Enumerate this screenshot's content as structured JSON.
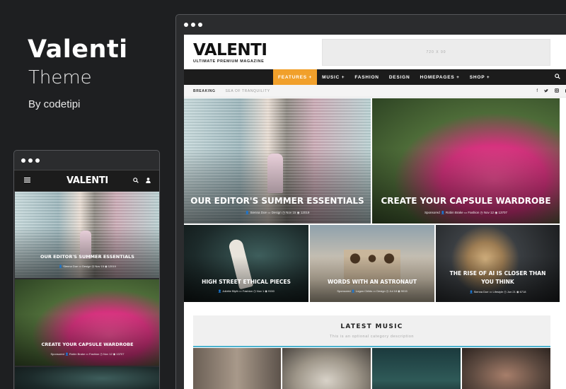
{
  "hero": {
    "title": "Valenti",
    "subtitle": "Theme",
    "by": "By codetipi"
  },
  "desktop": {
    "logo": "VALENTI",
    "tagline": "ULTIMATE PREMIUM MAGAZINE",
    "ad_text": "720 X 90",
    "nav": [
      {
        "label": "FEATURES +"
      },
      {
        "label": "MUSIC +"
      },
      {
        "label": "FASHION"
      },
      {
        "label": "DESIGN"
      },
      {
        "label": "HOMEPAGES +"
      },
      {
        "label": "SHOP +"
      }
    ],
    "breaking_label": "BREAKING",
    "breaking_text": "SEA OF TRANQUILITY",
    "big_cards": [
      {
        "title": "OUR EDITOR'S SUMMER ESSENTIALS",
        "meta": "👤 Sienna Doe  ▭ Design  ◷ Nov 15  ◉ 12019"
      },
      {
        "title": "CREATE YOUR CAPSULE WARDROBE",
        "meta": "Sponsored  👤 Robin Brake  ▭ Fashion  ◷ Nov 12  ◉ 13707"
      }
    ],
    "small_cards": [
      {
        "title": "HIGH STREET ETHICAL PIECES",
        "meta": "👤 Juliette Blyth  ▭ Fashion  ◷ Nov 1  ◉ 9150"
      },
      {
        "title": "WORDS WITH AN ASTRONAUT",
        "meta": "Sponsored  👤 Logan Childs  ▭ Design  ◷ Jul 18  ◉ 9015"
      },
      {
        "title": "THE RISE OF AI IS CLOSER THAN YOU THINK",
        "meta": "👤 Sienna Doe  ▭ Lifestyle  ◷ Jun 21  ◉ 6718"
      }
    ],
    "section_title": "LATEST MUSIC",
    "section_desc": "This is an optional category description"
  },
  "mobile": {
    "logo": "VALENTI",
    "cards": [
      {
        "title": "OUR EDITOR'S SUMMER ESSENTIALS",
        "meta": "👤 Sienna Doe  ▭ Design  ◷ Nov 15  ◉ 12019"
      },
      {
        "title": "CREATE YOUR CAPSULE WARDROBE",
        "meta": "Sponsored  👤 Robin Brake  ▭ Fashion  ◷ Nov 12  ◉ 13707"
      }
    ]
  },
  "icons": {
    "search": "search-icon",
    "user": "user-icon",
    "menu": "hamburger-menu-icon",
    "facebook": "facebook-icon",
    "twitter": "twitter-icon",
    "instagram": "instagram-icon",
    "youtube": "youtube-icon"
  },
  "colors": {
    "accent": "#f1a02b",
    "nav_bg": "#1c1c1c",
    "section_line": "#4bb3cf",
    "page_bg": "#1e1f21"
  }
}
